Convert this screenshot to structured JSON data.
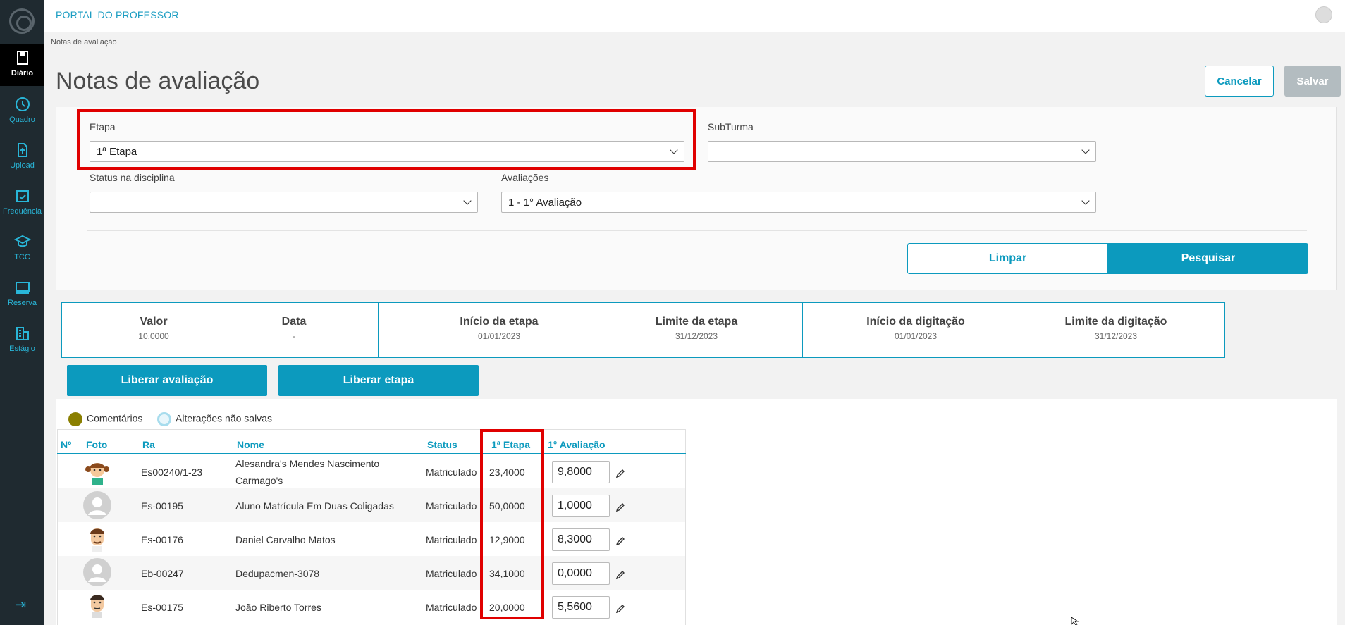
{
  "sidebar": {
    "items": [
      {
        "label": "Diário",
        "icon": "book-icon"
      },
      {
        "label": "Quadro",
        "icon": "clock-icon"
      },
      {
        "label": "Upload",
        "icon": "upload-icon"
      },
      {
        "label": "Frequência",
        "icon": "calendar-check-icon"
      },
      {
        "label": "TCC",
        "icon": "graduation-cap-icon"
      },
      {
        "label": "Reserva",
        "icon": "monitor-icon"
      },
      {
        "label": "Estágio",
        "icon": "building-icon"
      }
    ],
    "collapse_icon": "collapse-menu-icon"
  },
  "topbar": {
    "app_title": "PORTAL DO PROFESSOR"
  },
  "breadcrumb": "Notas de avaliação",
  "page_title": "Notas de avaliação",
  "actions": {
    "cancel_label": "Cancelar",
    "save_label": "Salvar"
  },
  "filters": {
    "etapa_label": "Etapa",
    "etapa_value": "1ª Etapa",
    "subturma_label": "SubTurma",
    "subturma_value": "",
    "status_label": "Status na disciplina",
    "status_value": "",
    "avaliacoes_label": "Avaliações",
    "avaliacoes_value": "1 - 1° Avaliação",
    "clear_label": "Limpar",
    "search_label": "Pesquisar"
  },
  "info": {
    "valor": {
      "title": "Valor",
      "value": "10,0000"
    },
    "data": {
      "title": "Data",
      "value": "-"
    },
    "inicio_etapa": {
      "title": "Início da etapa",
      "value": "01/01/2023"
    },
    "limite_etapa": {
      "title": "Limite da etapa",
      "value": "31/12/2023"
    },
    "inicio_digitacao": {
      "title": "Início da digitação",
      "value": "01/01/2023"
    },
    "limite_digitacao": {
      "title": "Limite da digitação",
      "value": "31/12/2023"
    }
  },
  "buttons": {
    "liberar_avaliacao": "Liberar avaliação",
    "liberar_etapa": "Liberar etapa"
  },
  "legend": {
    "comments": "Comentários",
    "unsaved": "Alterações não salvas",
    "comments_color": "#8a7f00",
    "unsaved_color": "#a7dced"
  },
  "table": {
    "headers": {
      "num": "Nº",
      "foto": "Foto",
      "ra": "Ra",
      "nome": "Nome",
      "status": "Status",
      "etapa": "1ª Etapa",
      "avaliacao": "1° Avaliação"
    },
    "rows": [
      {
        "ra": "Es00240/1-23",
        "nome_l1": "Alesandra's Mendes Nascimento",
        "nome_l2": "Carmago's",
        "status": "Matriculado",
        "etapa": "23,4000",
        "nota": "9,8000",
        "photo": "girl-avatar"
      },
      {
        "ra": "Es-00195",
        "nome_l1": "Aluno Matrícula Em Duas Coligadas",
        "nome_l2": "",
        "status": "Matriculado",
        "etapa": "50,0000",
        "nota": "1,0000",
        "photo": "default-avatar"
      },
      {
        "ra": "Es-00176",
        "nome_l1": "Daniel Carvalho Matos",
        "nome_l2": "",
        "status": "Matriculado",
        "etapa": "12,9000",
        "nota": "8,3000",
        "photo": "man-avatar"
      },
      {
        "ra": "Eb-00247",
        "nome_l1": "Dedupacmen-3078",
        "nome_l2": "",
        "status": "Matriculado",
        "etapa": "34,1000",
        "nota": "0,0000",
        "photo": "default-avatar"
      },
      {
        "ra": "Es-00175",
        "nome_l1": "João Riberto Torres",
        "nome_l2": "",
        "status": "Matriculado",
        "etapa": "20,0000",
        "nota": "5,5600",
        "photo": "man-avatar"
      }
    ]
  },
  "colors": {
    "accent": "#0c9abe",
    "sidebar": "#1f2a30",
    "highlight": "#e00000"
  }
}
